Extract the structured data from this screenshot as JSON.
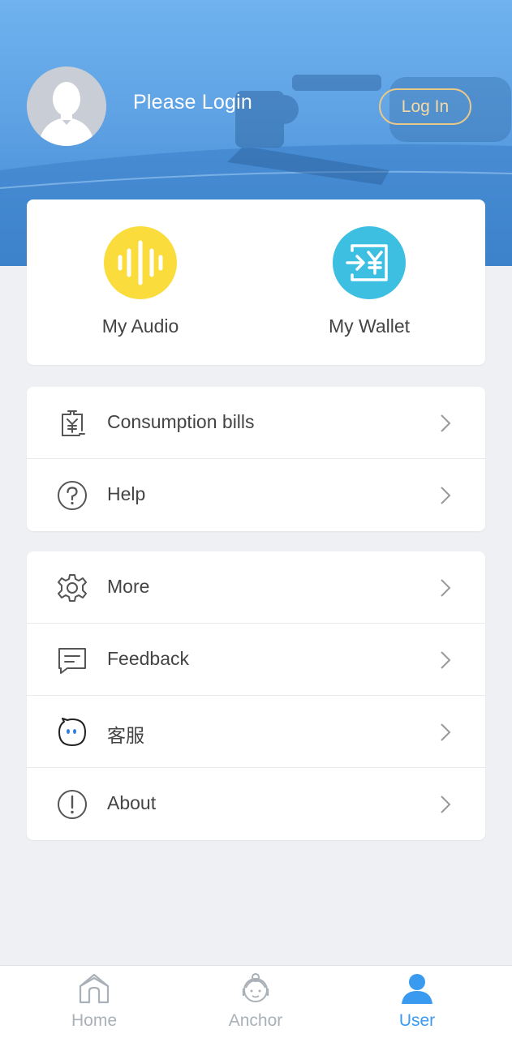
{
  "header": {
    "prompt": "Please Login",
    "login_button": "Log In"
  },
  "quick_actions": [
    {
      "label": "My Audio",
      "icon": "audio-wave-icon",
      "color": "#fadd3c"
    },
    {
      "label": "My Wallet",
      "icon": "wallet-exchange-icon",
      "color": "#3dbfe1"
    }
  ],
  "menu_group1": [
    {
      "label": "Consumption bills",
      "icon": "bill-icon"
    },
    {
      "label": "Help",
      "icon": "help-icon"
    }
  ],
  "menu_group2": [
    {
      "label": "More",
      "icon": "gear-icon"
    },
    {
      "label": "Feedback",
      "icon": "feedback-icon"
    },
    {
      "label": "客服",
      "icon": "customer-service-icon"
    },
    {
      "label": "About",
      "icon": "info-icon"
    }
  ],
  "tabs": [
    {
      "label": "Home",
      "icon": "home-icon",
      "active": false
    },
    {
      "label": "Anchor",
      "icon": "anchor-icon",
      "active": false
    },
    {
      "label": "User",
      "icon": "user-icon",
      "active": true
    }
  ],
  "colors": {
    "header_blue": "#5ea2e4",
    "accent_blue": "#3a9af0",
    "login_gold": "#e7c98a",
    "background": "#eef0f4"
  }
}
